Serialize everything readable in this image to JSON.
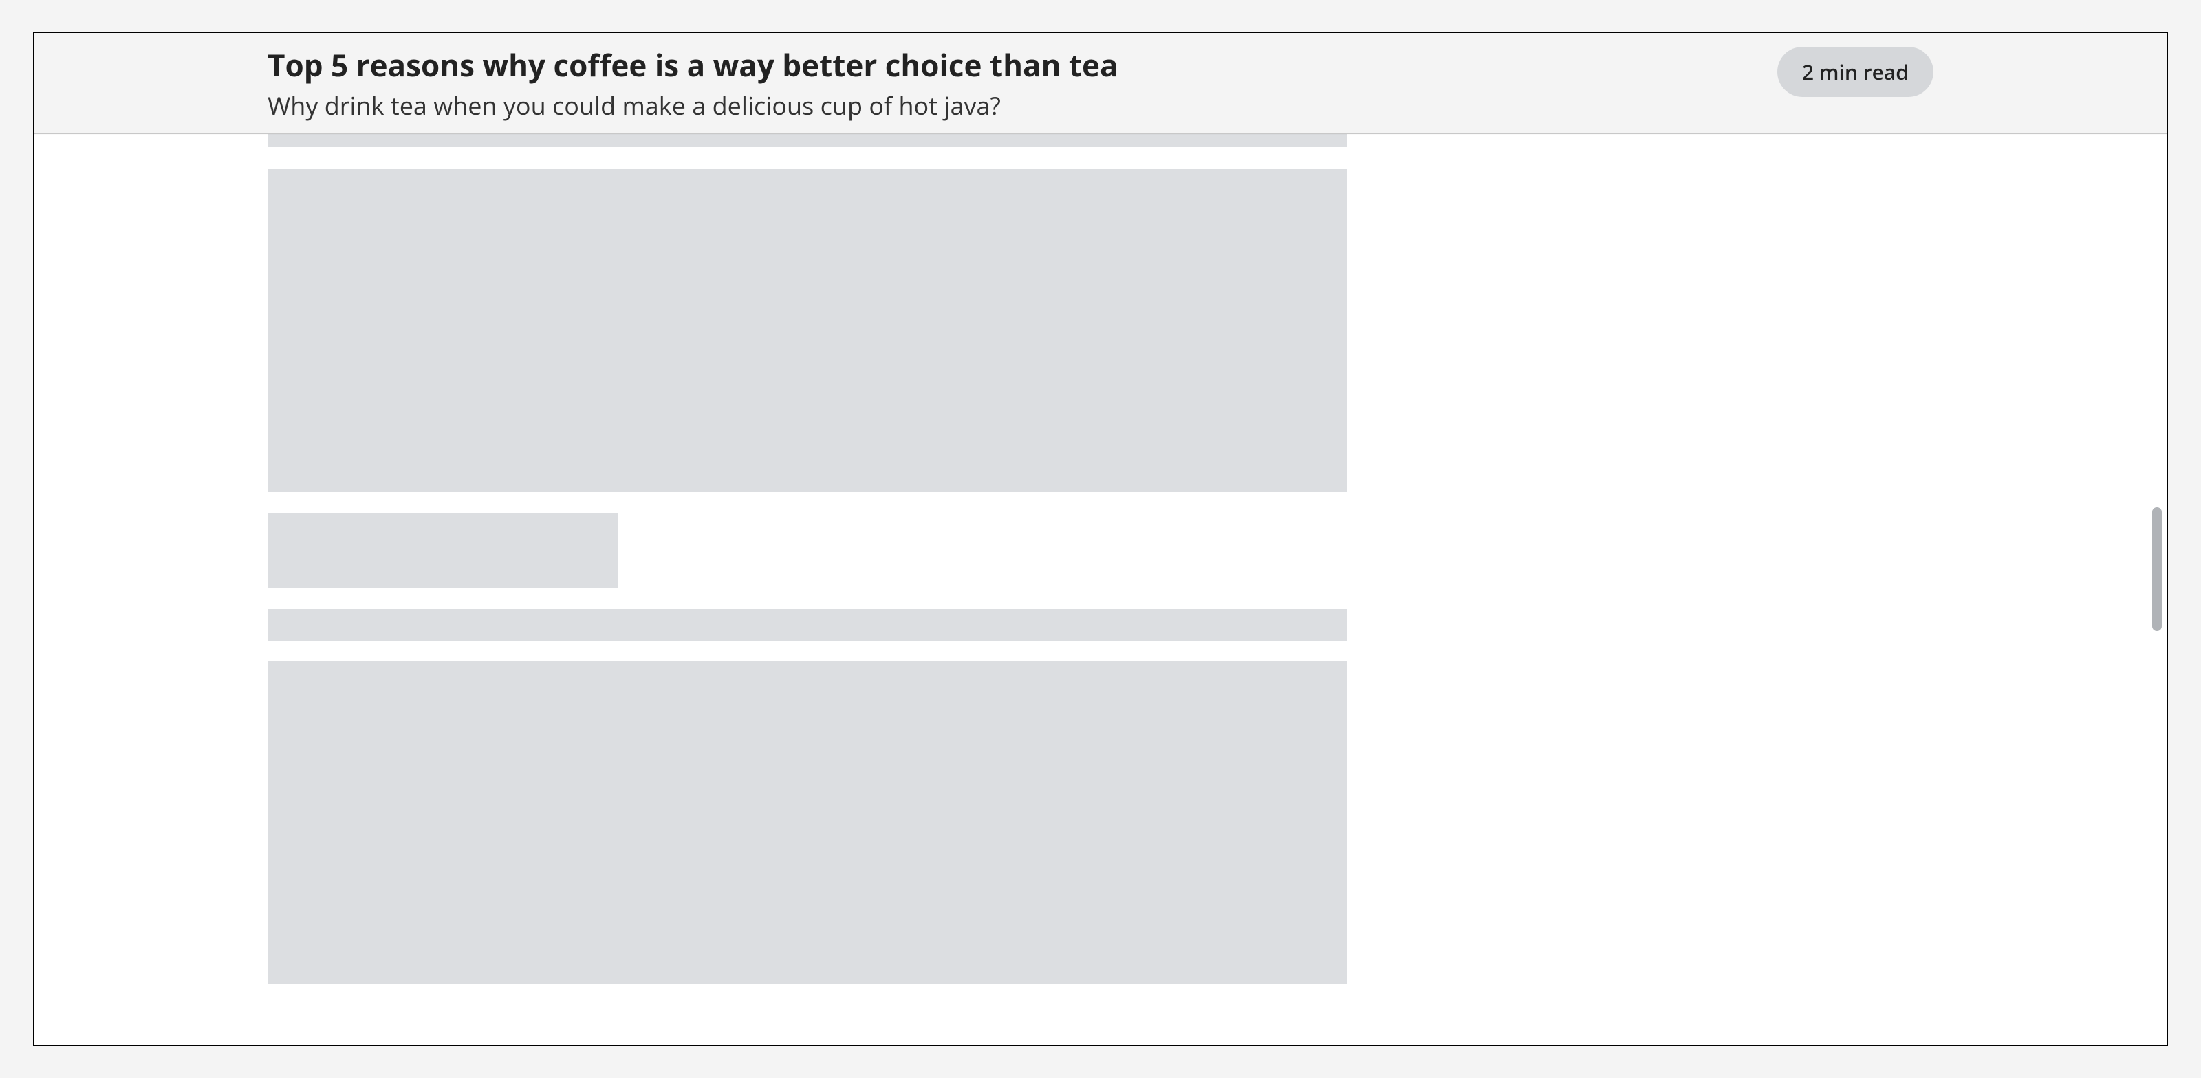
{
  "header": {
    "title": "Top 5 reasons why coffee is a way better choice than tea",
    "subtitle": "Why drink tea when you could make a delicious cup of hot java?",
    "read_time": "2 min read"
  }
}
